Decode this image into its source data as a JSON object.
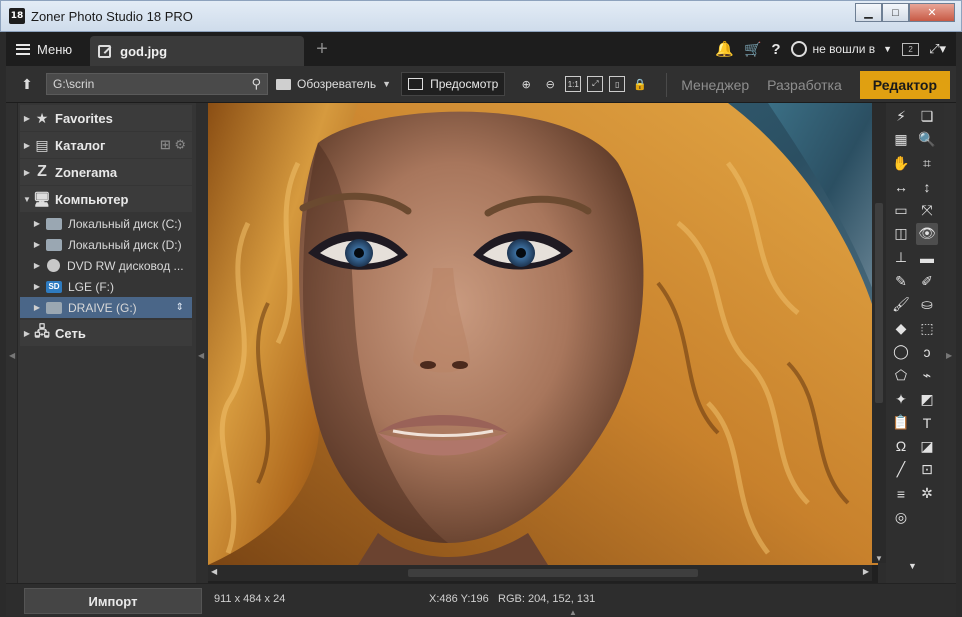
{
  "window": {
    "title": "Zoner Photo Studio 18 PRO",
    "app_icon_text": "18",
    "buttons": {
      "minimize": "▁",
      "maximize": "□",
      "close": "✕"
    }
  },
  "tabbar": {
    "menu_label": "Меню",
    "tab_label": "god.jpg",
    "add_tab": "+",
    "user_label": "не вошли в",
    "monitor_number": "2"
  },
  "toolbar": {
    "path_value": "G:\\scrin",
    "browser_label": "Обозреватель",
    "preview_label": "Предосмотр",
    "zoom_fit_label": "1:1",
    "modes": {
      "manager": "Менеджер",
      "develop": "Разработка",
      "editor": "Редактор"
    },
    "accent_color": "#e0a011"
  },
  "navigator": {
    "sections": [
      {
        "label": "Favorites",
        "icon": "star-icon"
      },
      {
        "label": "Каталог",
        "icon": "catalog-icon"
      },
      {
        "label": "Zonerama",
        "icon": "zonerama-icon"
      },
      {
        "label": "Компьютер",
        "icon": "computer-icon"
      }
    ],
    "drives": [
      {
        "label": "Локальный диск (C:)",
        "icon": "local-disk-icon"
      },
      {
        "label": "Локальный диск (D:)",
        "icon": "hard-drive-icon"
      },
      {
        "label": "DVD RW дисковод ...",
        "icon": "dvd-icon"
      },
      {
        "label": "LGE (F:)",
        "icon": "sd-card-icon",
        "badge": "SD"
      },
      {
        "label": "DRAIVE (G:)",
        "icon": "removable-drive-icon",
        "selected": true
      }
    ],
    "network": {
      "label": "Сеть",
      "icon": "network-icon"
    }
  },
  "status": {
    "import_label": "Импорт",
    "dimensions": "911 x 484 x 24",
    "coordinates": "X:486 Y:196",
    "rgb": "RGB: 204, 152, 131"
  },
  "tools": [
    "lightning-icon",
    "layers-icon",
    "histogram-icon",
    "zoom-icon",
    "hand-icon",
    "crop-icon",
    "straighten-icon",
    "vertical-resize-icon",
    "select-rect-icon",
    "transform-icon",
    "levels-icon",
    "redeye-icon",
    "stamp-icon",
    "eraser-icon",
    "heal-brush-icon",
    "retouch-icon",
    "brush-icon",
    "bucket-icon",
    "clear-icon",
    "rect-select-icon",
    "ellipse-select-icon",
    "lasso-icon",
    "polygon-lasso-icon",
    "magnetic-lasso-icon",
    "magic-wand-icon",
    "gradient-icon",
    "paste-icon",
    "text-icon",
    "symbol-icon",
    "shape-icon",
    "line-icon",
    "picture-icon",
    "stripe-icon",
    "settings-icon",
    "frame-icon"
  ]
}
